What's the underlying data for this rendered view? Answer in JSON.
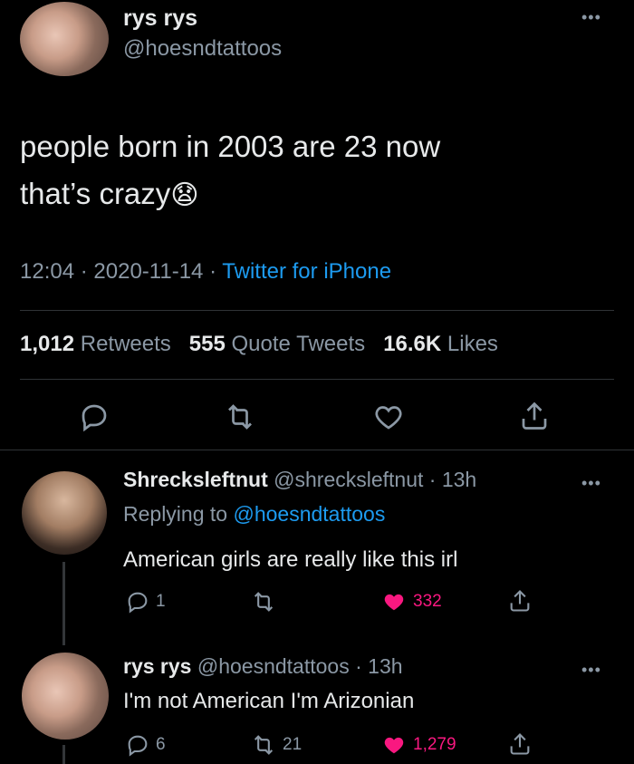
{
  "main_tweet": {
    "display_name": "rys rys",
    "handle": "@hoesndtattoos",
    "text_line1": "people born in 2003 are 23 now",
    "text_line2": "that’s crazy",
    "emoji": "😧",
    "time": "12:04",
    "date": "2020-11-14",
    "sep": "·",
    "client": "Twitter for iPhone",
    "retweets_count": "1,012",
    "retweets_label": "Retweets",
    "quotes_count": "555",
    "quotes_label": "Quote Tweets",
    "likes_count": "16.6K",
    "likes_label": "Likes"
  },
  "reply1": {
    "display_name": "Shrecksleftnut",
    "handle": "@shrecksleftnut",
    "time": "· 13h",
    "replying_prefix": "Replying to",
    "replying_handle": "@hoesndtattoos",
    "text": "American girls are really like this irl",
    "replies": "1",
    "retweets": "",
    "likes": "332"
  },
  "reply2": {
    "display_name": "rys rys",
    "handle": "@hoesndtattoos",
    "time": "· 13h",
    "text": "I'm not American I'm Arizonian",
    "replies": "6",
    "retweets": "21",
    "likes": "1,279"
  },
  "colors": {
    "background": "#000000",
    "text": "#e7e9ea",
    "muted": "#8b98a5",
    "link": "#1d9bf0",
    "like": "#f91880",
    "divider": "#2f3336"
  },
  "icons": [
    "more-icon",
    "reply-icon",
    "retweet-icon",
    "like-icon",
    "share-icon",
    "liked-heart-icon"
  ]
}
